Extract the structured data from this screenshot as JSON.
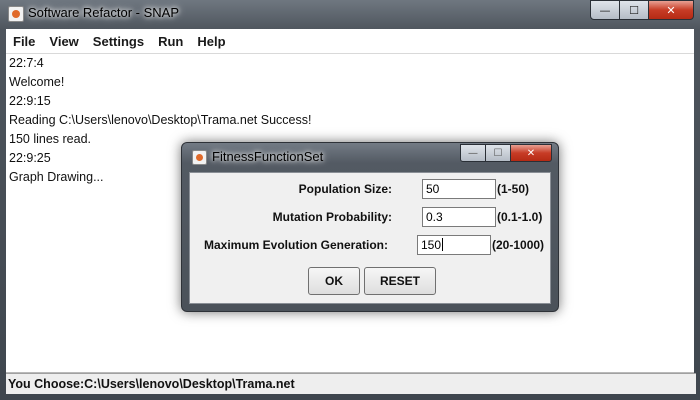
{
  "window": {
    "title": "Software Refactor - SNAP",
    "controls": {
      "minimize": "—",
      "maximize": "☐",
      "close": "✕"
    }
  },
  "menu": [
    "File",
    "View",
    "Settings",
    "Run",
    "Help"
  ],
  "log": [
    "22:7:4",
    "Welcome!",
    "22:9:15",
    "Reading C:\\Users\\lenovo\\Desktop\\Trama.net Success!",
    "150 lines read.",
    "22:9:25",
    "Graph Drawing..."
  ],
  "status_bar": "You Choose:C:\\Users\\lenovo\\Desktop\\Trama.net",
  "dialog": {
    "title": "FitnessFunctionSet",
    "fields": [
      {
        "label": "Population Size:",
        "value": "50",
        "range": "(1-50)"
      },
      {
        "label": "Mutation Probability:",
        "value": "0.3",
        "range": "(0.1-1.0)"
      },
      {
        "label": "Maximum Evolution Generation:",
        "value": "150",
        "range": "(20-1000)"
      }
    ],
    "ok_label": "OK",
    "reset_label": "RESET"
  },
  "icons": {
    "app": "app-icon",
    "dialog": "dialog-app-icon"
  }
}
